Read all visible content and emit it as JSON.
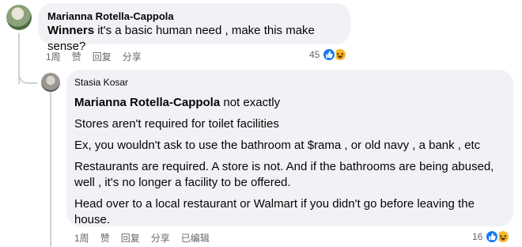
{
  "comment": {
    "author": "Marianna Rotella-Cappola",
    "mention": "Winners",
    "text": " it's a basic human need , make this make sense?",
    "actions": {
      "time": "1周",
      "like": "赞",
      "reply": "回复",
      "share": "分享"
    },
    "reaction_count": "45",
    "reactions": [
      "like-icon",
      "haha-icon"
    ]
  },
  "reply": {
    "author": "Stasia Kosar",
    "mention": "Marianna Rotella-Cappola",
    "first_line": " not exactly",
    "paragraphs": [
      "Stores aren't required for toilet facilities",
      "Ex, you wouldn't ask to use the bathroom at $rama , or old navy , a bank , etc",
      "Restaurants are required. A store is not. And if the bathrooms are being abused, well , it's no longer a facility to be offered.",
      "Head over to a local restaurant or Walmart if you didn't go before leaving the house."
    ],
    "actions": {
      "time": "1周",
      "like": "赞",
      "reply": "回复",
      "share": "分享",
      "edited": "已编辑"
    },
    "reaction_count": "16",
    "reactions": [
      "like-icon",
      "haha-icon"
    ]
  },
  "colors": {
    "bubble": "#f0f2f5",
    "like": "#1877f2",
    "haha": "#f7b928",
    "meta": "#65676b"
  }
}
